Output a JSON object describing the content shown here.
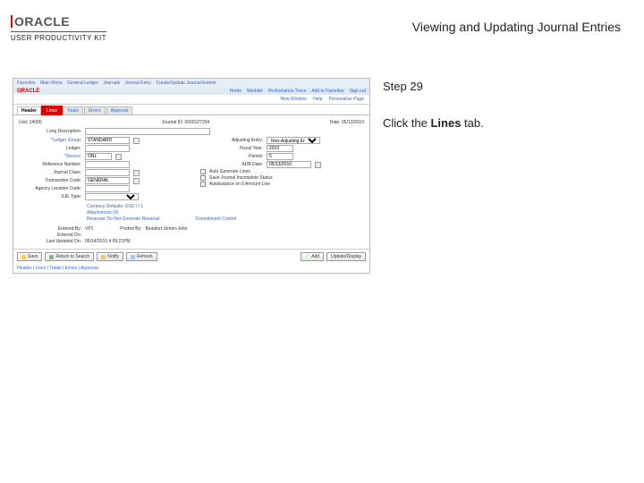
{
  "header": {
    "brand_word": "ORACLE",
    "upk": "USER PRODUCTIVITY KIT",
    "doc_title": "Viewing and Updating Journal Entries"
  },
  "instructions": {
    "step_label": "Step 29",
    "text_prefix": "Click the ",
    "text_bold": "Lines",
    "text_suffix": " tab."
  },
  "app": {
    "breadcrumb": [
      "Favorites",
      "Main Menu",
      "General Ledger",
      "Journals",
      "Journal Entry",
      "Create/Update Journal Entries"
    ],
    "mini_logo": "ORACLE",
    "top_menu": [
      "Home",
      "Worklist",
      "Performance Trace",
      "Add to Favorites",
      "Sign out"
    ],
    "subhead_links": [
      "New Window",
      "Help",
      "Personalize Page"
    ],
    "tabs": {
      "header": "Header",
      "lines": "Lines",
      "totals": "Totals",
      "errors": "Errors",
      "approval": "Approval"
    },
    "form": {
      "unit_label": "Unit:",
      "unit_val": "14000",
      "jid_label": "Journal ID:",
      "jid_val": "0000127294",
      "date_label": "Date:",
      "date_val": "05/13/2010",
      "longdesc_label": "Long Description:",
      "longdesc_val": "",
      "ledgergrp_label": "*Ledger Group:",
      "ledgergrp_val": "STANDARD",
      "adjent_label": "Adjusting Entry:",
      "adjent_val": "Non-Adjusting Entry",
      "ledger_label": "Ledger:",
      "fy_label": "Fiscal Year:",
      "fy_val": "2010",
      "source_label": "*Source:",
      "source_val": "ONL",
      "period_label": "Period:",
      "period_val": "5",
      "refno_label": "Reference Number:",
      "adb_label": "ADB Date:",
      "adb_val": "05/13/2010",
      "jclass_label": "Journal Class:",
      "tcode_label": "Transaction Code:",
      "tcode_val": "GENERAL",
      "autogen_label": "Auto Generate Lines",
      "agency_label": "Agency Location Code:",
      "savejinc_label": "Save Journal Incomplete Status",
      "sjetype_label": "SJE Type:",
      "autobal_label": "Autobalance on 0 Amount Line",
      "link_curr": "Currency Defaults: USD / / 1",
      "link_attach": "Attachments (0)",
      "link_rev": "Reversal: Do Not Generate Reversal",
      "link_comm": "Commitment Control"
    },
    "status": {
      "entby_label": "Entered By:",
      "entby_val": "VP1",
      "enton_label": "Entered On:",
      "lastupd_label": "Last Updated On:",
      "lastupd_val": "05/14/2010 4:09:21PM",
      "postby_label": "Posted By:",
      "postby_val": "Beaufort,Simon-John"
    },
    "footer_btns": {
      "save": "Save",
      "return": "Return to Search",
      "notify": "Notify",
      "refresh": "Refresh",
      "add": "Add",
      "updisp": "Update/Display"
    },
    "footer_tabs": "Header | Lines | Totals | Errors | Approval"
  }
}
